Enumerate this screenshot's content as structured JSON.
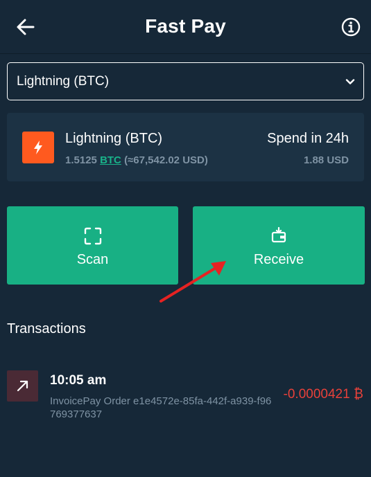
{
  "header": {
    "title": "Fast Pay",
    "back_icon": "arrow-left-icon",
    "info_icon": "info-circle-icon"
  },
  "network_select": {
    "value": "Lightning (BTC)",
    "chevron_icon": "chevron-down-icon"
  },
  "wallet": {
    "name": "Lightning (BTC)",
    "balance_amount": "1.5125",
    "balance_currency": "BTC",
    "balance_fiat": "(≈67,542.02 USD)",
    "spend_label": "Spend in 24h",
    "spend_value": "1.88 USD",
    "icon": "lightning-bolt-icon",
    "icon_color": "#ff5a1f"
  },
  "actions": {
    "scan_label": "Scan",
    "receive_label": "Receive",
    "scan_icon": "scan-frame-icon",
    "receive_icon": "wallet-receive-icon",
    "button_color": "#18b084"
  },
  "transactions": {
    "title": "Transactions",
    "items": [
      {
        "time": "10:05 am",
        "description": "InvoicePay Order e1e4572e-85fa-442f-a939-f96769377637",
        "amount": "-0.0000421 ₿",
        "direction_icon": "arrow-up-right-icon",
        "amount_color": "#e8413a"
      }
    ]
  },
  "colors": {
    "background": "#162838",
    "card": "#1c3244",
    "accent": "#18b084",
    "negative": "#e8413a",
    "annotation": "#e52222"
  }
}
